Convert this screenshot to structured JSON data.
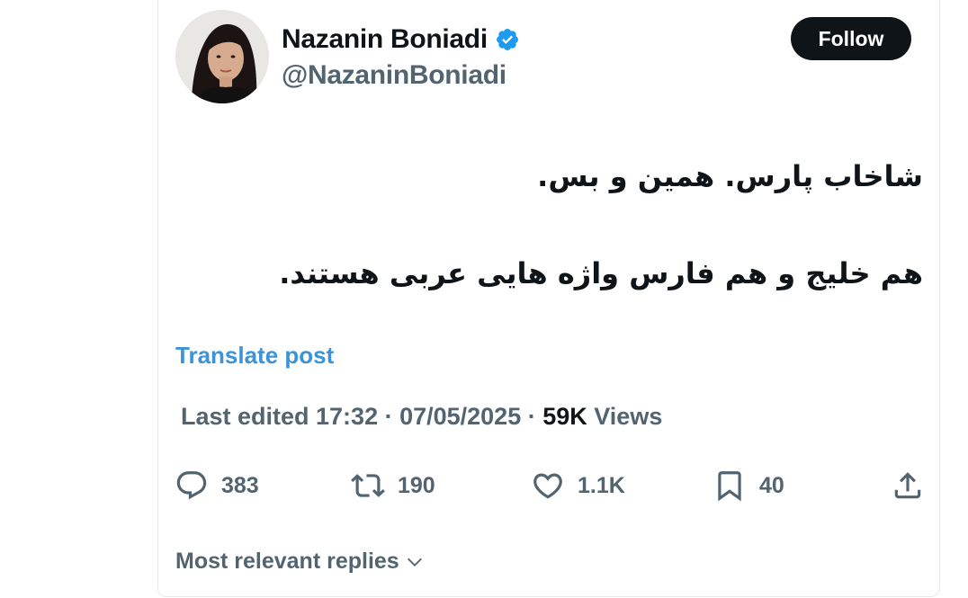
{
  "author": {
    "name": "Nazanin Boniadi",
    "handle": "@NazaninBoniadi",
    "verified": true,
    "verified_icon": "verified-badge-icon"
  },
  "follow_button": {
    "label": "Follow"
  },
  "tweet": {
    "line1": "شاخاب پارس. همین و بس.",
    "line2": "هم خلیج و هم فارس واژه هایی عربی هستند."
  },
  "translate": {
    "label": "Translate post"
  },
  "meta": {
    "edited": "Last edited 17:32 · 07/05/2025 ·",
    "views_count": "59K",
    "views_label": "Views"
  },
  "actions": {
    "replies": "383",
    "reposts": "190",
    "likes": "1.1K",
    "bookmarks": "40"
  },
  "replies_sort": {
    "label": "Most relevant replies"
  },
  "colors": {
    "link": "#3b94d9",
    "secondary_text": "#536471",
    "primary_text": "#0f1419",
    "verified": "#1d9bf0"
  }
}
